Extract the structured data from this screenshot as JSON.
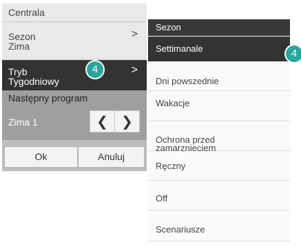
{
  "left_panel": {
    "header": "Centrala",
    "items": [
      {
        "label_line1": "Sezon",
        "label_line2": "Zima",
        "chevron": ">"
      },
      {
        "label_line1": "Tryb",
        "label_line2": "Tygodniowy",
        "chevron": ">",
        "selected": true,
        "badge": "4"
      }
    ],
    "next_program": {
      "title": "Następny program",
      "value": "Zima 1",
      "prev": "❮",
      "next": "❯"
    },
    "buttons": {
      "ok": "Ok",
      "cancel": "Anuluj"
    }
  },
  "right_panel": {
    "header": "Sezon",
    "badge": "4",
    "items": [
      {
        "label": "Settimanale",
        "selected": true
      },
      {
        "label": "Dni powszednie"
      },
      {
        "label": "Wakacje"
      },
      {
        "label_line1": "Ochrona przed",
        "label_line2": "zamarznięciem"
      },
      {
        "label": "Ręczny"
      },
      {
        "label": "Off"
      },
      {
        "label": "Scenariusze"
      }
    ]
  },
  "colors": {
    "badge": "#2aa59e",
    "selected_bg": "#333333",
    "panel_bg": "#e9e9e9",
    "program_bg": "#9f9f9f"
  }
}
